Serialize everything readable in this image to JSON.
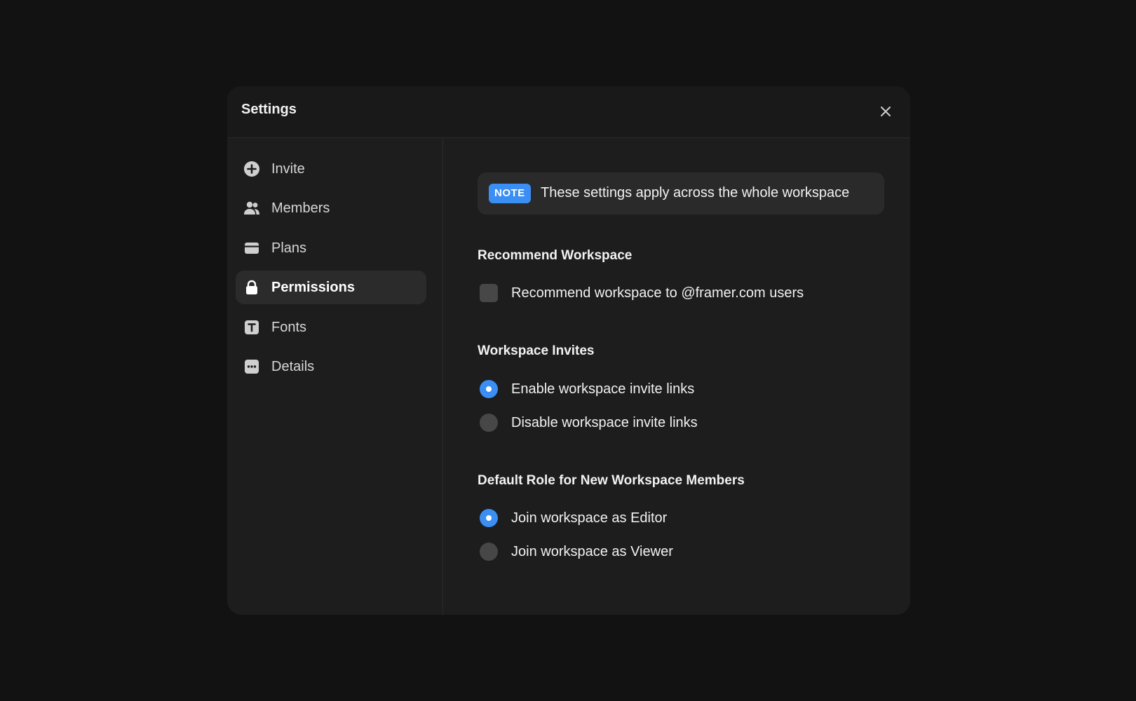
{
  "modal": {
    "title": "Settings",
    "close_icon": "close-icon"
  },
  "sidebar": {
    "items": [
      {
        "label": "Invite",
        "icon": "plus-circle-icon",
        "active": false
      },
      {
        "label": "Members",
        "icon": "users-icon",
        "active": false
      },
      {
        "label": "Plans",
        "icon": "card-icon",
        "active": false
      },
      {
        "label": "Permissions",
        "icon": "lock-icon",
        "active": true
      },
      {
        "label": "Fonts",
        "icon": "font-icon",
        "active": false
      },
      {
        "label": "Details",
        "icon": "dots-icon",
        "active": false
      }
    ]
  },
  "note": {
    "badge": "NOTE",
    "text": "These settings apply across the whole workspace"
  },
  "recommend": {
    "title": "Recommend Workspace",
    "option_label": "Recommend workspace to @framer.com users",
    "checked": false
  },
  "invites": {
    "title": "Workspace Invites",
    "options": [
      {
        "label": "Enable workspace invite links",
        "selected": true
      },
      {
        "label": "Disable workspace invite links",
        "selected": false
      }
    ]
  },
  "default_role": {
    "title": "Default Role for New Workspace Members",
    "options": [
      {
        "label": "Join workspace as Editor",
        "selected": true
      },
      {
        "label": "Join workspace as Viewer",
        "selected": false
      }
    ]
  },
  "colors": {
    "accent": "#3b8ef3",
    "background": "#121212",
    "modal": "#1d1d1d"
  }
}
